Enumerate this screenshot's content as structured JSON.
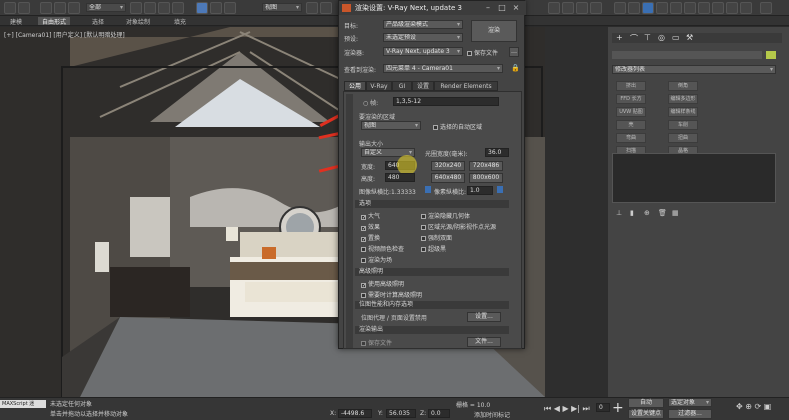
{
  "toolbar": {
    "view_dropdown": "视图",
    "selection_dropdown": "全部"
  },
  "subbar": {
    "tabs": [
      "建模",
      "自由形式",
      "选择",
      "对象绘制",
      "填充"
    ]
  },
  "viewport": {
    "label": "[+] [Camera01] [用户定义] [默认明暗处理]"
  },
  "right_panel": {
    "modifier_list": "修改器列表",
    "buttons": [
      "挤出",
      "倒角",
      "FFD 长方",
      "编辑多边形",
      "UVW 贴图",
      "编辑样条线",
      "壳",
      "车削",
      "弯曲",
      "扭曲",
      "扫描",
      "晶格"
    ],
    "colors": {
      "accent": "#b5c94a"
    }
  },
  "dialog": {
    "title": "渲染设置: V-Ray Next, update 3",
    "target_label": "目标:",
    "target_value": "产品级渲染模式",
    "preset_label": "预设:",
    "preset_value": "未选定预设",
    "renderer_label": "渲染器:",
    "renderer_value": "V-Ray Next, update 3",
    "save_file_label": "保存文件",
    "render_button": "渲染",
    "view_label": "查看到渲染:",
    "view_value": "四元菜单 4 - Camera01",
    "tabs": [
      "公用",
      "V-Ray",
      "GI",
      "设置",
      "Render Elements"
    ],
    "frames_label": "帧:",
    "frames_value": "1,3,5-12",
    "area_group": "要渲染的区域",
    "area_value": "视图",
    "auto_region_label": "选择的自动区域",
    "output_group": "输出大小",
    "output_value": "自定义",
    "aperture_label": "光圈宽度(毫米):",
    "aperture_value": "36.0",
    "width_label": "宽度:",
    "width_value": "640",
    "height_label": "高度:",
    "height_value": "480",
    "res_buttons": [
      "320x240",
      "720x486",
      "640x480",
      "800x600"
    ],
    "image_aspect_label": "图像纵横比:",
    "image_aspect_value": "1.33333",
    "pixel_aspect_label": "像素纵横比:",
    "pixel_aspect_value": "1.0",
    "options_group": "选项",
    "options": [
      {
        "label": "大气",
        "checked": true
      },
      {
        "label": "渲染隐藏几何体",
        "checked": false
      },
      {
        "label": "效果",
        "checked": true
      },
      {
        "label": "区域光源/阴影视作点光源",
        "checked": false
      },
      {
        "label": "置换",
        "checked": true
      },
      {
        "label": "强制双面",
        "checked": false
      },
      {
        "label": "视频颜色检查",
        "checked": false
      },
      {
        "label": "超级黑",
        "checked": false
      },
      {
        "label": "渲染为场",
        "checked": false
      }
    ],
    "adv_group": "高级照明",
    "adv_options": [
      {
        "label": "使用高级照明",
        "checked": true
      },
      {
        "label": "需要时计算高级照明",
        "checked": false
      }
    ],
    "bitmap_group": "位图性能和内存选项",
    "bitmap_text": "位图代理 / 页面设置禁用",
    "setup_button": "设置...",
    "output_render_group": "渲染输出",
    "save_file_option": "保存文件",
    "files_button": "文件..."
  },
  "statusbar": {
    "script": "MAXScript 迷",
    "msg1": "未选定任何对象",
    "msg2": "单击并拖动以选择并移动对象",
    "x_label": "X:",
    "x_value": "-4498.6",
    "y_label": "Y:",
    "y_value": "56.035",
    "z_label": "Z:",
    "z_value": "0.0",
    "grid": "栅格 = 10.0",
    "add_time_tag": "添加时间标记",
    "auto_key": "自动",
    "selected_dropdown": "选定对象",
    "set_key": "设置关键点",
    "filters": "过滤器...",
    "frame": "0"
  }
}
